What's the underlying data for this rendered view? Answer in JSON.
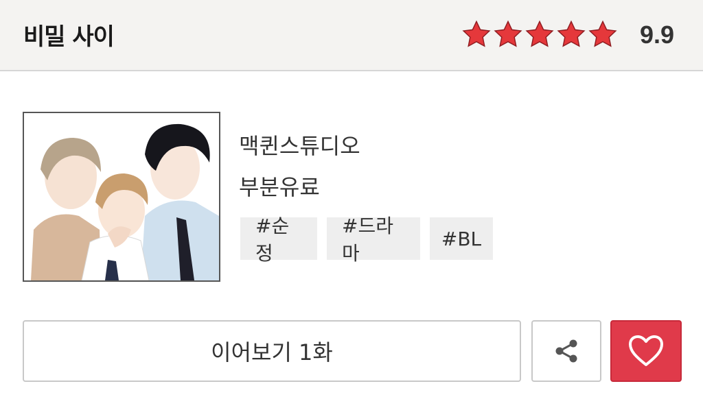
{
  "header": {
    "title": "비밀 사이",
    "rating": {
      "score": "9.9",
      "stars_filled": 5,
      "stars_total": 5,
      "star_color": "#e5383b"
    }
  },
  "work": {
    "author": "맥퀸스튜디오",
    "price_type": "부분유료",
    "tags": [
      "#순정",
      "#드라마",
      "#BL"
    ]
  },
  "actions": {
    "continue_label": "이어보기 1화",
    "share_icon": "share-icon",
    "like_icon": "heart-icon",
    "like_color": "#e03a4a"
  }
}
